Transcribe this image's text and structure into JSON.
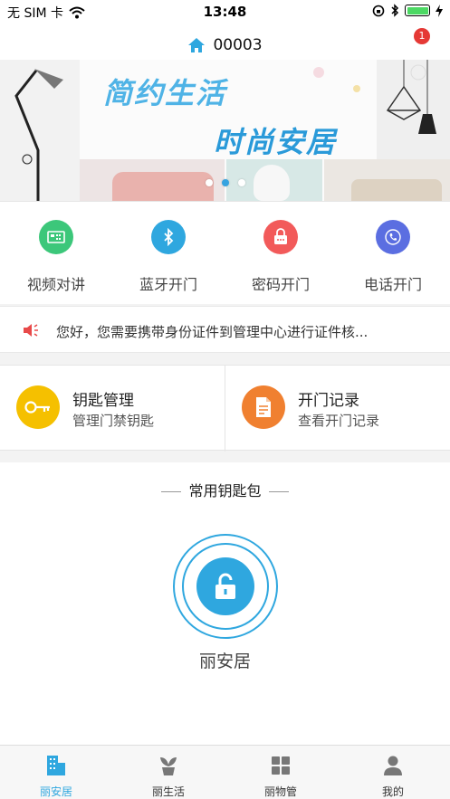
{
  "status_bar": {
    "carrier": "无 SIM 卡",
    "time": "13:48"
  },
  "nav": {
    "title": "00003",
    "notification_count": "1"
  },
  "banner": {
    "line1": "简约生活",
    "line2": "时尚安居",
    "slide_count": 3,
    "active_slide": 2
  },
  "quick_actions": [
    {
      "label": "视频对讲",
      "icon": "video-intercom-icon",
      "color": "#3cc77a"
    },
    {
      "label": "蓝牙开门",
      "icon": "bluetooth-icon",
      "color": "#2fa7df"
    },
    {
      "label": "密码开门",
      "icon": "lock-keypad-icon",
      "color": "#f25a5a"
    },
    {
      "label": "电话开门",
      "icon": "phone-icon",
      "color": "#5b6ee1"
    }
  ],
  "notice": {
    "icon": "speaker-icon",
    "text": "您好，您需要携带身份证件到管理中心进行证件核..."
  },
  "management": [
    {
      "title": "钥匙管理",
      "subtitle": "管理门禁钥匙",
      "icon": "key-icon",
      "color": "#f5c000"
    },
    {
      "title": "开门记录",
      "subtitle": "查看开门记录",
      "icon": "document-icon",
      "color": "#f08030"
    }
  ],
  "keys": {
    "heading": "常用钥匙包",
    "key_name": "丽安居",
    "accent": "#2fa7df"
  },
  "tabbar": [
    {
      "label": "丽安居",
      "icon": "building-icon",
      "active": true
    },
    {
      "label": "丽生活",
      "icon": "plant-icon",
      "active": false
    },
    {
      "label": "丽物管",
      "icon": "grid-icon",
      "active": false
    },
    {
      "label": "我的",
      "icon": "person-icon",
      "active": false
    }
  ]
}
